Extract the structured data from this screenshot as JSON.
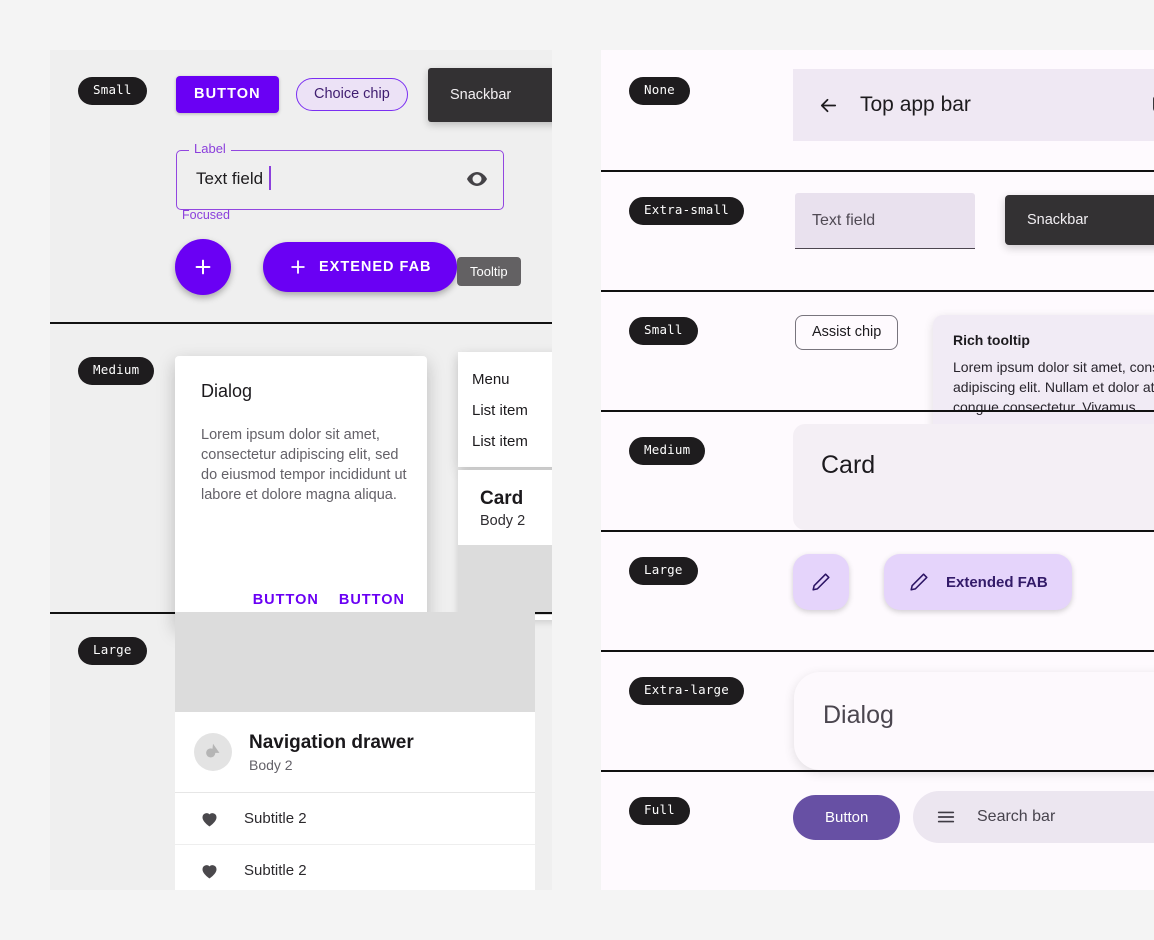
{
  "left_panel": {
    "sections": [
      {
        "tag": "Small",
        "button_label": "BUTTON",
        "chip_label": "Choice chip",
        "snackbar_label": "Snackbar",
        "textfield": {
          "label": "Label",
          "value": "Text field",
          "helper": "Focused",
          "trailing_icon": "visibility-eye-icon"
        },
        "fab_icon": "plus-icon",
        "extended_fab_label": "EXTENED FAB",
        "tooltip_label": "Tooltip"
      },
      {
        "tag": "Medium",
        "dialog": {
          "title": "Dialog",
          "body": "Lorem ipsum dolor sit amet, consectetur adipiscing elit, sed do eiusmod tempor incididunt ut labore et dolore magna aliqua.",
          "action_1": "BUTTON",
          "action_2": "BUTTON"
        },
        "menu": {
          "header": "Menu",
          "items": [
            "List item",
            "List item"
          ]
        },
        "card": {
          "title": "Card",
          "body": "Body 2"
        }
      },
      {
        "tag": "Large",
        "nav_drawer": {
          "title": "Navigation drawer",
          "subtitle": "Body 2",
          "avatar_icon": "account-avatar-icon",
          "rows": [
            {
              "icon": "heart-icon",
              "label": "Subtitle 2"
            },
            {
              "icon": "heart-icon",
              "label": "Subtitle 2"
            }
          ]
        }
      }
    ]
  },
  "right_panel": {
    "sections": [
      {
        "tag": "None",
        "top_app_bar": {
          "back_icon": "arrow-left-icon",
          "title": "Top app bar",
          "action_icon": "attachment-paperclip-icon"
        }
      },
      {
        "tag": "Extra-small",
        "textfield_placeholder": "Text field",
        "snackbar_label": "Snackbar"
      },
      {
        "tag": "Small",
        "assist_chip_label": "Assist chip",
        "rich_tooltip": {
          "title": "Rich tooltip",
          "body": "Lorem ipsum dolor sit amet, consectetur adipiscing elit. Nullam et dolor at lorem congue consectetur. Vivamus"
        }
      },
      {
        "tag": "Medium",
        "card_title": "Card"
      },
      {
        "tag": "Large",
        "fab_icon": "pencil-edit-icon",
        "extended_fab_label": "Extended FAB"
      },
      {
        "tag": "Extra-large",
        "dialog_title": "Dialog"
      },
      {
        "tag": "Full",
        "button_label": "Button",
        "search_bar": {
          "menu_icon": "hamburger-menu-icon",
          "placeholder": "Search bar"
        }
      }
    ]
  },
  "colors": {
    "primary_purple": "#6a00f4",
    "accent_violet": "#6750a4",
    "tag_dark": "#1e1c1e",
    "container_lavender": "#e5d4fb",
    "page_bg": "#f4f4f4"
  }
}
